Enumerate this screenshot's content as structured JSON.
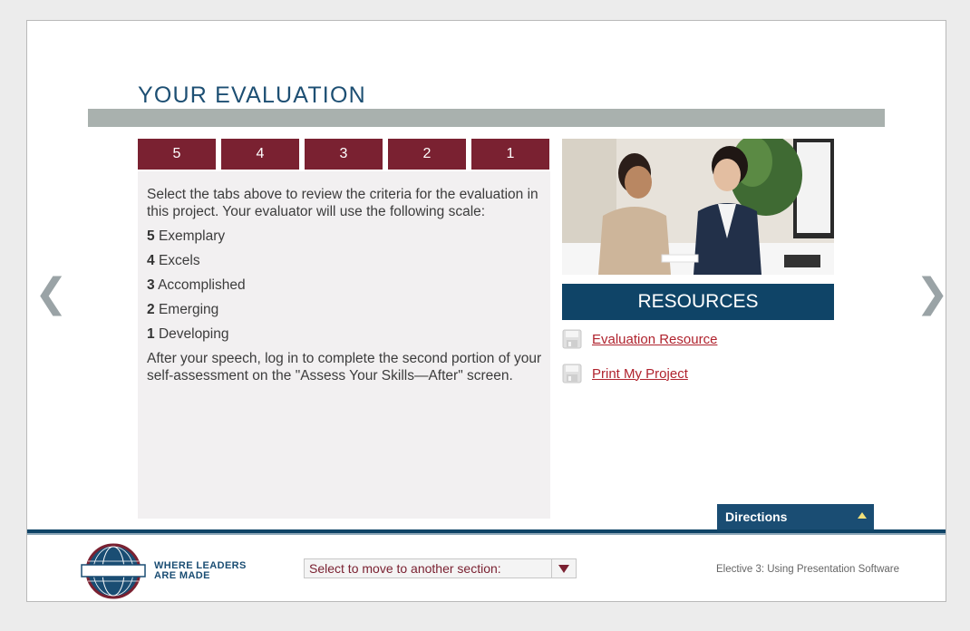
{
  "page": {
    "title": "YOUR EVALUATION"
  },
  "tabs": [
    "5",
    "4",
    "3",
    "2",
    "1"
  ],
  "panel": {
    "intro": "Select the tabs above to review the criteria for the evaluation in this project. Your evaluator will use the following scale:",
    "scale": [
      {
        "num": "5",
        "label": "Exemplary"
      },
      {
        "num": "4",
        "label": "Excels"
      },
      {
        "num": "3",
        "label": "Accomplished"
      },
      {
        "num": "2",
        "label": "Emerging"
      },
      {
        "num": "1",
        "label": "Developing"
      }
    ],
    "outro": "After your speech, log in to complete the second portion of your self-assessment on the \"Assess Your Skills—After\" screen."
  },
  "resources": {
    "header": "RESOURCES",
    "links": [
      "Evaluation Resource",
      "Print My Project"
    ]
  },
  "nav": {
    "prev_icon": "chevron-left-icon",
    "next_icon": "chevron-right-icon"
  },
  "directions": {
    "label": "Directions"
  },
  "footer": {
    "tagline_line1": "WHERE LEADERS",
    "tagline_line2": "ARE MADE",
    "section_select_placeholder": "Select to move to another section:",
    "course_title": "Elective 3: Using Presentation Software"
  },
  "colors": {
    "tab_bg": "#7a2131",
    "header_blue": "#0f4467",
    "title_blue": "#1d4f73",
    "link_red": "#b0232e"
  }
}
